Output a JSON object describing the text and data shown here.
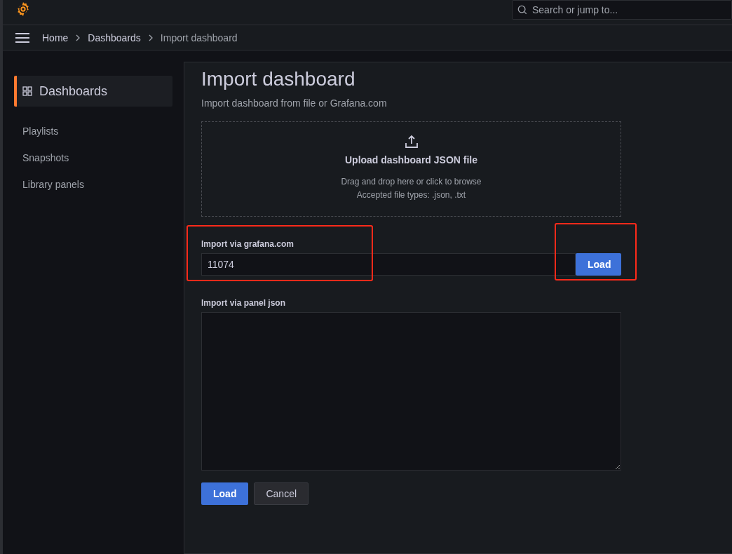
{
  "search": {
    "placeholder": "Search or jump to..."
  },
  "breadcrumbs": [
    {
      "label": "Home",
      "current": false
    },
    {
      "label": "Dashboards",
      "current": false
    },
    {
      "label": "Import dashboard",
      "current": true
    }
  ],
  "sidebar": {
    "items": [
      {
        "label": "Dashboards",
        "selected": true
      },
      {
        "label": "Playlists",
        "selected": false
      },
      {
        "label": "Snapshots",
        "selected": false
      },
      {
        "label": "Library panels",
        "selected": false
      }
    ]
  },
  "page": {
    "title": "Import dashboard",
    "subtitle": "Import dashboard from file or Grafana.com",
    "upload": {
      "title": "Upload dashboard JSON file",
      "hint": "Drag and drop here or click to browse",
      "types": "Accepted file types: .json, .txt"
    },
    "grafana_import": {
      "label": "Import via grafana.com",
      "value": "11074",
      "highlighted": true,
      "button": {
        "label": "Load",
        "highlighted": true
      }
    },
    "panel_json": {
      "label": "Import via panel json"
    },
    "buttons": [
      {
        "label": "Load",
        "kind": "primary"
      },
      {
        "label": "Cancel",
        "kind": "secondary"
      }
    ]
  }
}
